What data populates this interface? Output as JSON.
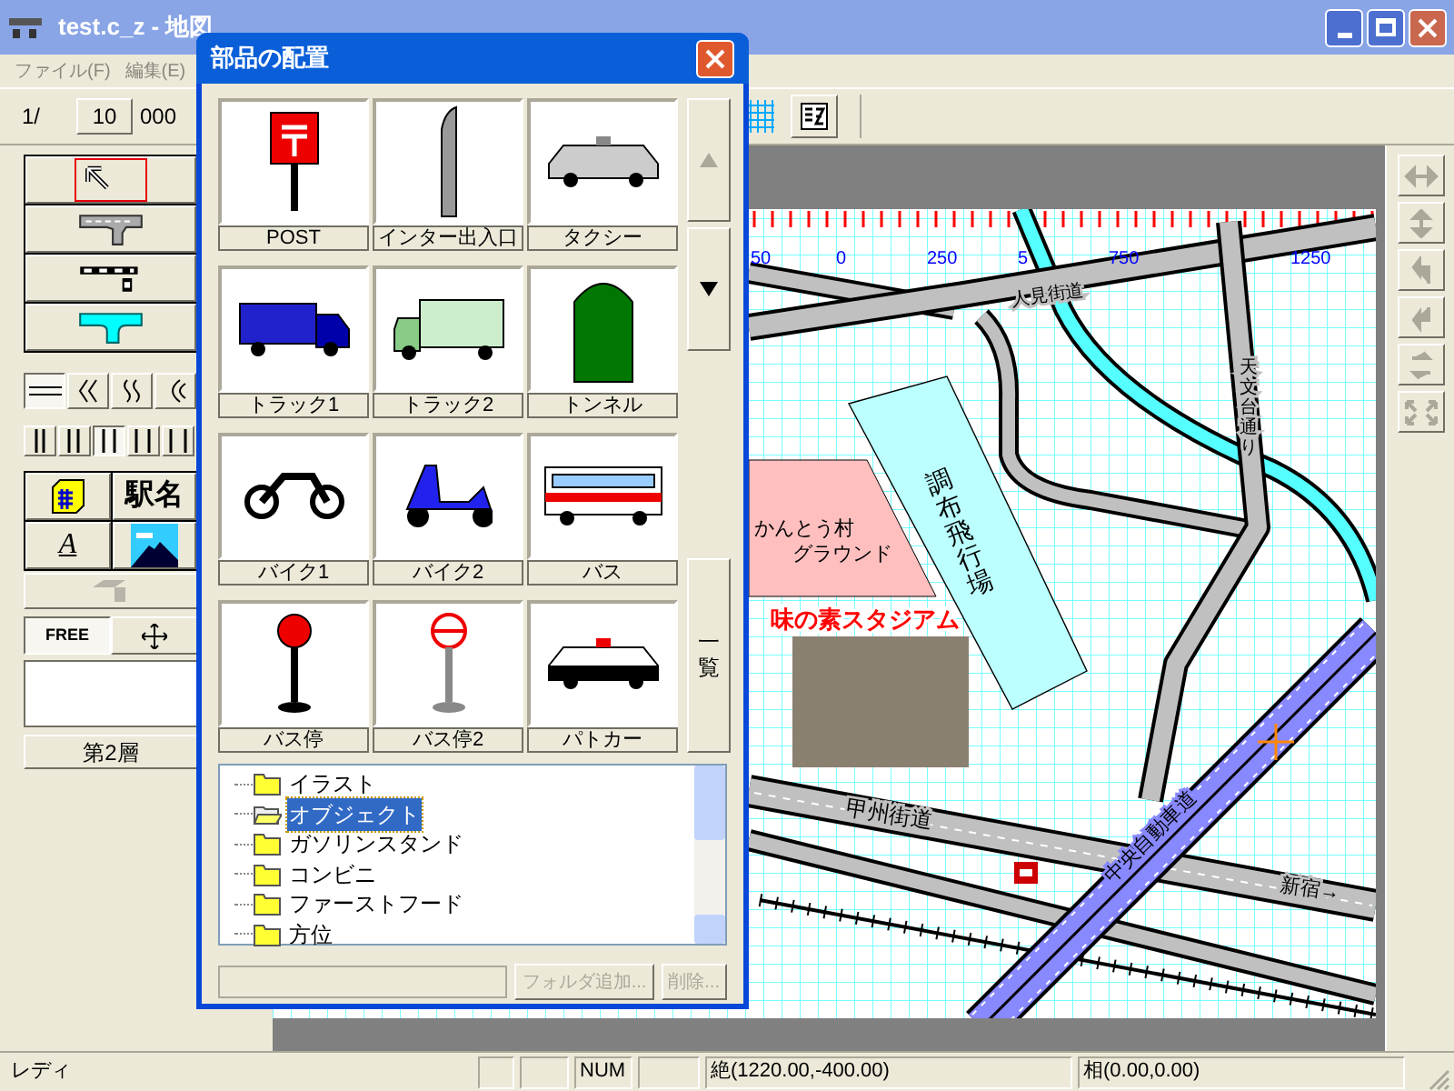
{
  "window": {
    "title": "test.c_z - 地図"
  },
  "menu": [
    {
      "label": "ファイル(F)"
    },
    {
      "label": "編集(E)"
    }
  ],
  "scale": {
    "prefix": "1/",
    "value": "10",
    "suffix": "000"
  },
  "toolbar_buttons": [
    {
      "kind": "grid"
    },
    {
      "kind": "settings"
    }
  ],
  "tools": [
    {
      "kind": "pointer",
      "selected": true
    },
    {
      "kind": "road",
      "selected": false
    },
    {
      "kind": "rail",
      "selected": false
    },
    {
      "kind": "river",
      "selected": false
    }
  ],
  "line_styles": [
    {
      "kind": "straight",
      "selected": true
    },
    {
      "kind": "zigzag",
      "selected": false
    },
    {
      "kind": "wave",
      "selected": false
    },
    {
      "kind": "arc",
      "selected": false
    }
  ],
  "line_widths": [
    {
      "selected": false
    },
    {
      "selected": false
    },
    {
      "selected": true
    },
    {
      "selected": false
    },
    {
      "selected": false
    }
  ],
  "objects": [
    {
      "kind": "building"
    },
    {
      "kind": "text",
      "label": "駅名"
    },
    {
      "kind": "letter",
      "label": "A"
    },
    {
      "kind": "picture"
    }
  ],
  "shadow_button": {
    "disabled": true
  },
  "mode_buttons": [
    {
      "kind": "text",
      "label": "FREE",
      "selected": true
    },
    {
      "kind": "move",
      "selected": false
    }
  ],
  "layer_button": "第2層",
  "dialog": {
    "title": "部品の配置",
    "parts": [
      {
        "kind": "postbox",
        "label": "POST"
      },
      {
        "kind": "interchange",
        "label": "インター出入口"
      },
      {
        "kind": "taxi",
        "label": "タクシー"
      },
      {
        "kind": "truck_blue",
        "label": "トラック1"
      },
      {
        "kind": "truck_green",
        "label": "トラック2"
      },
      {
        "kind": "tunnel",
        "label": "トンネル"
      },
      {
        "kind": "motorbike",
        "label": "バイク1"
      },
      {
        "kind": "scooter",
        "label": "バイク2"
      },
      {
        "kind": "bus",
        "label": "バス"
      },
      {
        "kind": "busstop",
        "label": "バス停"
      },
      {
        "kind": "busstop2",
        "label": "バス停2"
      },
      {
        "kind": "police",
        "label": "パトカー"
      }
    ],
    "list_button": "一覧",
    "folders": [
      {
        "label": "イラスト",
        "selected": false
      },
      {
        "label": "オブジェクト",
        "selected": true
      },
      {
        "label": "ガソリンスタンド",
        "selected": false
      },
      {
        "label": "コンビニ",
        "selected": false
      },
      {
        "label": "ファーストフード",
        "selected": false
      },
      {
        "label": "方位",
        "selected": false
      }
    ],
    "buttons": [
      {
        "label": "フォルダ追加...",
        "disabled": true
      },
      {
        "label": "削除...",
        "disabled": true
      }
    ]
  },
  "map": {
    "ruler": [
      "50",
      "0",
      "250",
      "5",
      "750",
      "1250"
    ],
    "labels": [
      {
        "kind": "road",
        "text": "人見街道"
      },
      {
        "kind": "vertical",
        "text": "天文台通り"
      },
      {
        "kind": "place",
        "text": "かんとう村"
      },
      {
        "kind": "place2",
        "text": "グラウンド"
      },
      {
        "kind": "airfield",
        "text": "調布飛行場"
      },
      {
        "kind": "landmark",
        "text": "味の素スタジアム"
      },
      {
        "kind": "road2",
        "text": "甲州街道"
      },
      {
        "kind": "expressway",
        "text": "中央自動車道"
      },
      {
        "kind": "direction",
        "text": "新宿→"
      }
    ]
  },
  "side_tools": [
    {
      "kind": "hflip",
      "disabled": true
    },
    {
      "kind": "vflip",
      "disabled": true
    },
    {
      "kind": "turn_left",
      "disabled": true
    },
    {
      "kind": "turn_right",
      "disabled": true
    },
    {
      "kind": "swap",
      "disabled": true
    },
    {
      "kind": "fit",
      "disabled": true
    }
  ],
  "status_bar": {
    "message": "レディ",
    "indicator": "NUM",
    "absolute": "絶(1220.00,-400.00)",
    "relative": "相(0.00,0.00)"
  }
}
